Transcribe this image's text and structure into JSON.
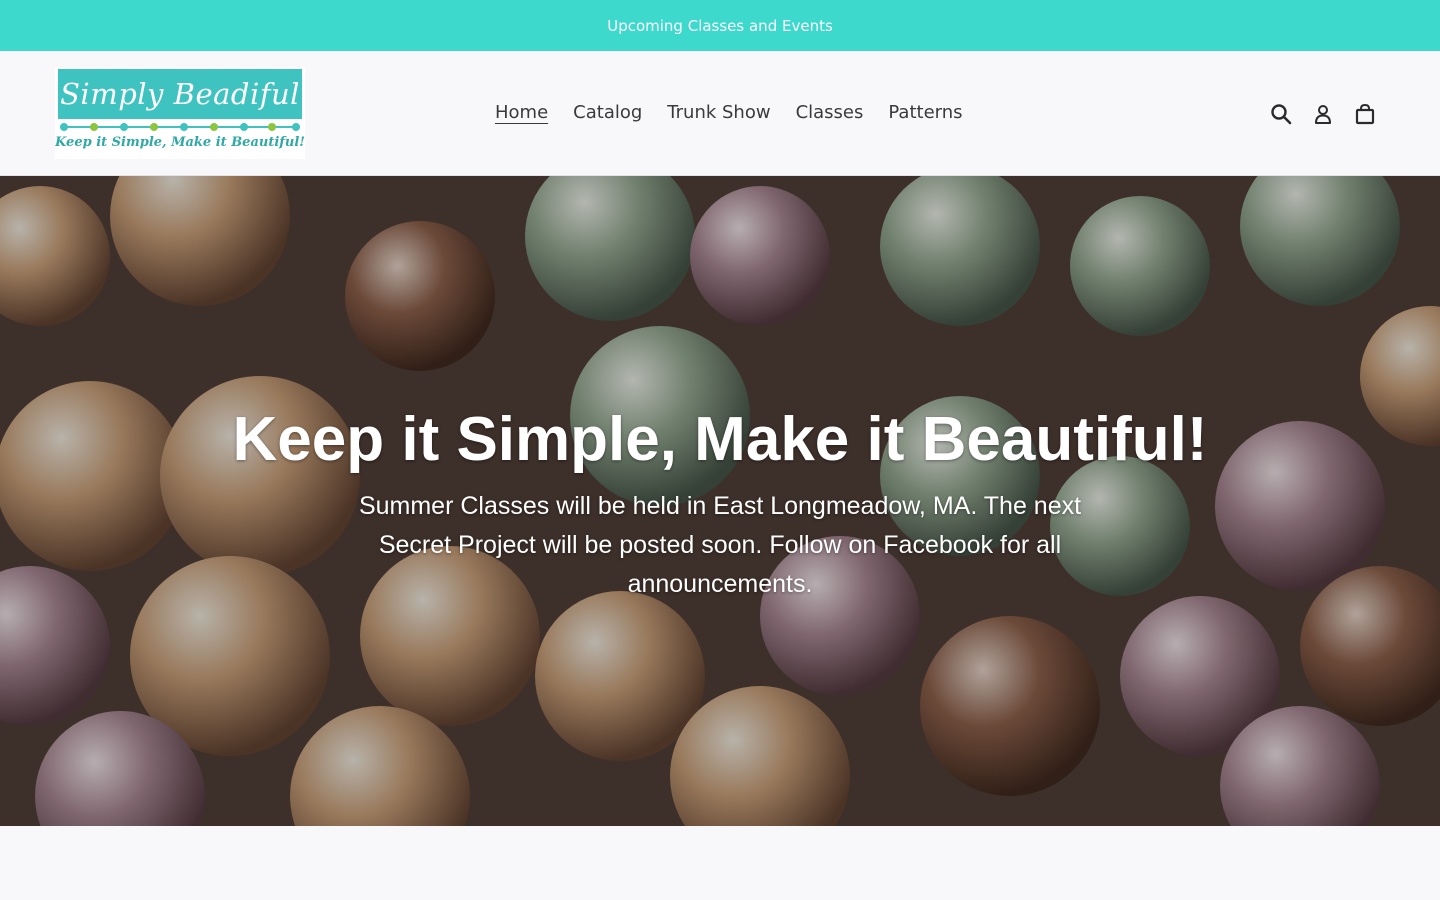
{
  "announcement": {
    "text": "Upcoming Classes and Events"
  },
  "logo": {
    "title": "Simply Beadiful",
    "tagline": "Keep it Simple, Make it Beautiful!"
  },
  "nav": {
    "items": [
      {
        "label": "Home",
        "active": true
      },
      {
        "label": "Catalog"
      },
      {
        "label": "Trunk Show"
      },
      {
        "label": "Classes"
      },
      {
        "label": "Patterns"
      }
    ]
  },
  "header_icons": [
    "search-icon",
    "account-icon",
    "cart-icon"
  ],
  "hero": {
    "title": "Keep it Simple, Make it Beautiful!",
    "subtitle": "Summer Classes will be held in East Longmeadow, MA. The next Secret Project will be posted soon. Follow on Facebook for all announcements."
  },
  "colors": {
    "announcement_bg": "#3dd9cc",
    "logo_bg": "#3fc3c0",
    "text_dark": "#3a3a3a"
  }
}
